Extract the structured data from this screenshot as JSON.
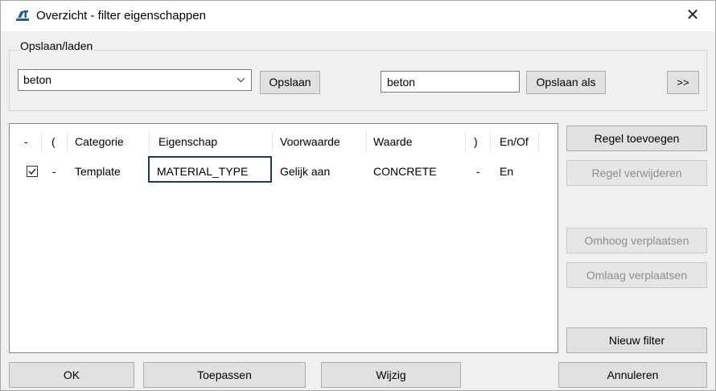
{
  "window": {
    "title": "Overzicht - filter eigenschappen",
    "close_glyph": "✕",
    "icon": "app-logo-icon"
  },
  "save_load": {
    "group_label": "Opslaan/laden",
    "selected_filter": "beton",
    "save_label": "Opslaan",
    "save_as_name": "beton",
    "save_as_label": "Opslaan als",
    "more_label": ">>"
  },
  "table": {
    "headers": [
      "-",
      "(",
      "Categorie",
      "Eigenschap",
      "Voorwaarde",
      "Waarde",
      ")",
      "En/Of"
    ],
    "rows": [
      {
        "checked": true,
        "dash": "-",
        "category": "Template",
        "property": "MATERIAL_TYPE",
        "condition": "Gelijk aan",
        "value": "CONCRETE",
        "close_paren": "-",
        "and_or": "En"
      }
    ]
  },
  "side_buttons": {
    "add_row": "Regel toevoegen",
    "remove_row": "Regel verwijderen",
    "move_up": "Omhoog verplaatsen",
    "move_down": "Omlaag verplaatsen",
    "new_filter": "Nieuw filter"
  },
  "footer": {
    "ok": "OK",
    "apply": "Toepassen",
    "modify": "Wijzig",
    "cancel": "Annuleren"
  }
}
